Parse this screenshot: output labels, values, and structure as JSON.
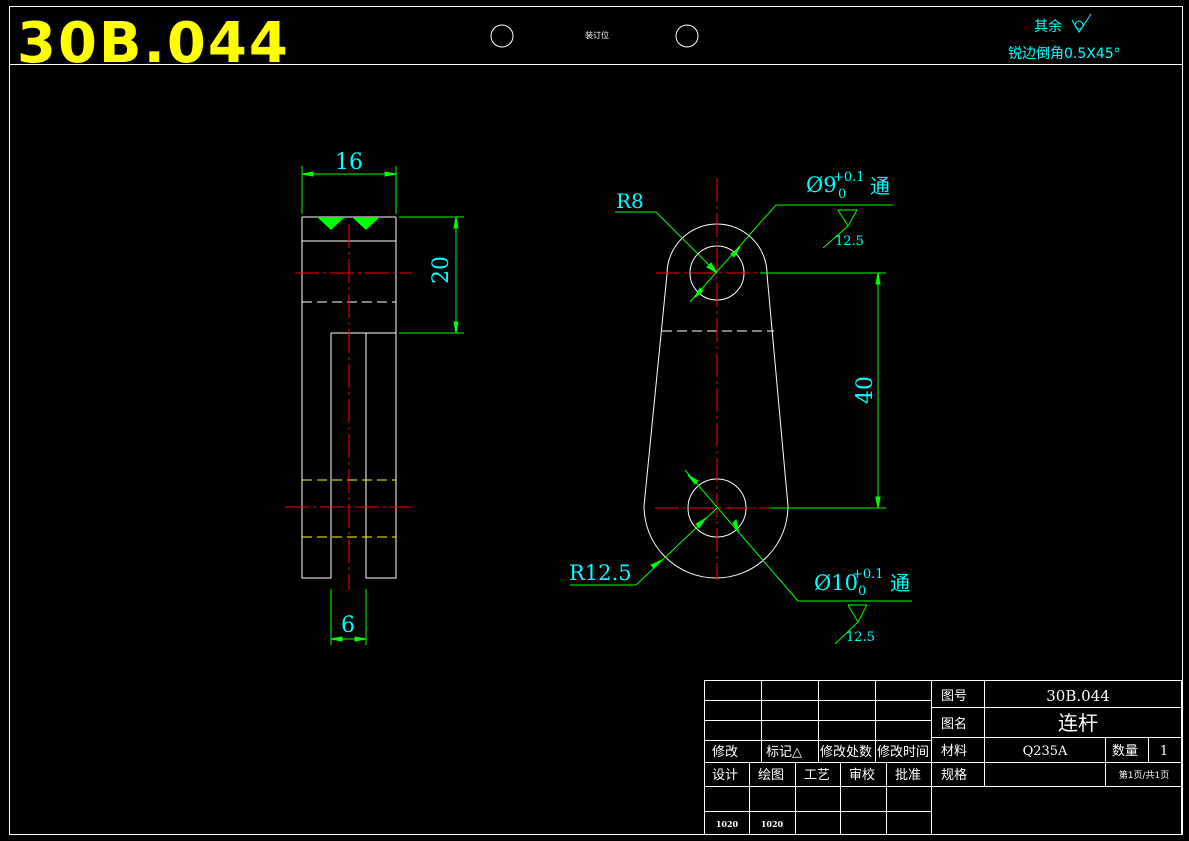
{
  "header": {
    "drawing_code": "30B.044",
    "binding_mark": "装订位",
    "other_roughness": "其余",
    "chamfer_note": "锐边倒角0.5X45°"
  },
  "colors": {
    "background": "#000000",
    "outline": "#ffffff",
    "dimension": "#00ff00",
    "dim_text": "#00ffff",
    "centerline": "#ff0000",
    "hidden": "#ffff00",
    "title_code": "#ffff00"
  },
  "side_view": {
    "width_dim": "16",
    "height_dim": "20",
    "slot_dim": "6"
  },
  "front_view": {
    "r_small": "R8",
    "r_large": "R12.5",
    "center_distance": "40",
    "hole_small": {
      "prefix": "Ø9",
      "tol_upper": "+0.1",
      "tol_lower": "0",
      "suffix": "通",
      "roughness": "12.5"
    },
    "hole_large": {
      "prefix": "Ø10",
      "tol_upper": "+0.1",
      "tol_lower": "0",
      "suffix": "通",
      "roughness": "12.5"
    }
  },
  "title_block": {
    "drawing_no_label": "图号",
    "drawing_no": "30B.044",
    "name_label": "图名",
    "name": "连杆",
    "material_label": "材料",
    "material": "Q235A",
    "quantity_label": "数量",
    "quantity": "1",
    "spec_label": "规格",
    "page_info": "第1页/共1页",
    "revision_headers": [
      "修改",
      "标记△",
      "修改处数",
      "修改时间"
    ],
    "role_headers": [
      "设计",
      "绘图",
      "工艺",
      "审校",
      "批准"
    ],
    "dates": [
      "1020",
      "1020"
    ]
  }
}
